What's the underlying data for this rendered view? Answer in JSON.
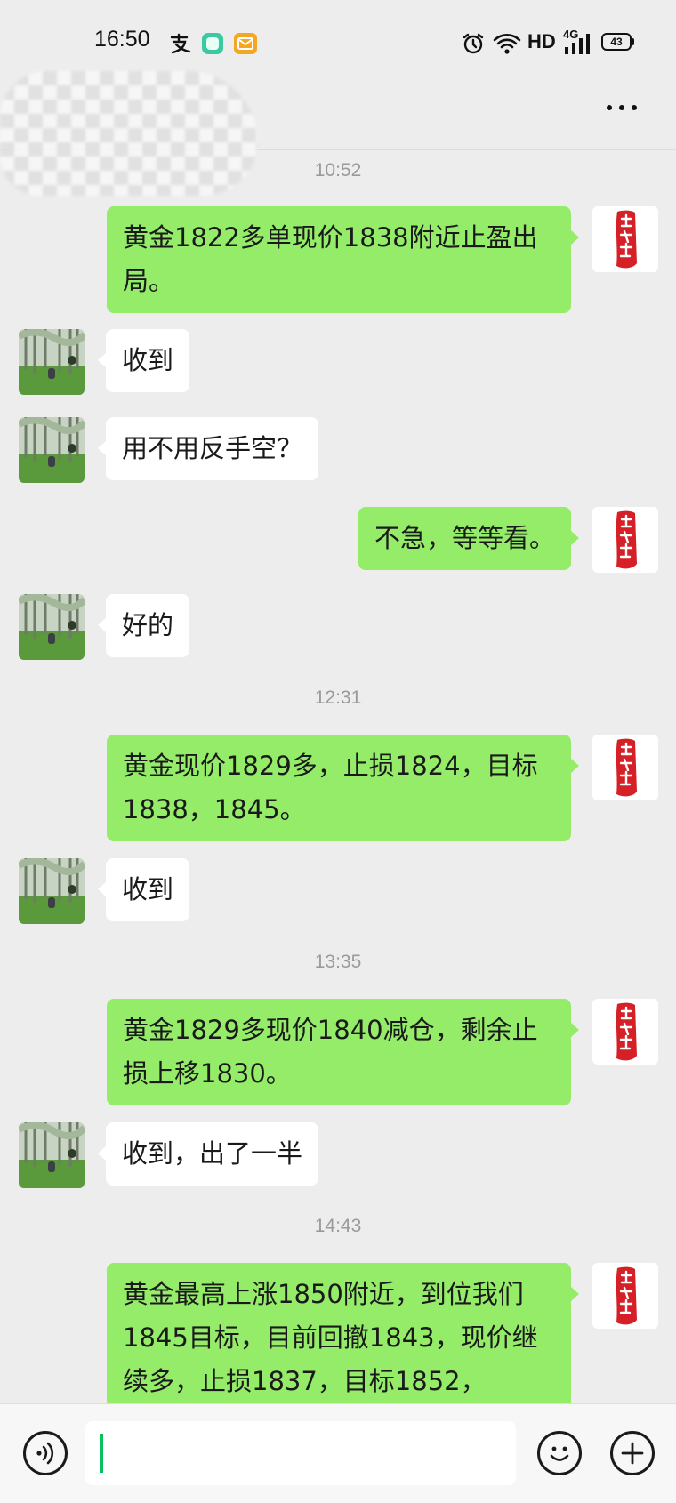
{
  "status_bar": {
    "time": "16:50",
    "network": "HD",
    "signal": "4G",
    "battery": "43",
    "notification_icons": [
      "alipay-icon",
      "green-app-icon",
      "mail-icon"
    ]
  },
  "header": {
    "contact_name": "",
    "more_label": "…"
  },
  "messages": [
    {
      "type": "timestamp",
      "text": "10:52"
    },
    {
      "type": "message",
      "side": "out",
      "text": "黄金1822多单现价1838附近止盈出局。"
    },
    {
      "type": "message",
      "side": "in",
      "text": "收到"
    },
    {
      "type": "message",
      "side": "in",
      "text": "用不用反手空？"
    },
    {
      "type": "message",
      "side": "out",
      "text": "不急，等等看。"
    },
    {
      "type": "message",
      "side": "in",
      "text": "好的"
    },
    {
      "type": "timestamp",
      "text": "12:31"
    },
    {
      "type": "message",
      "side": "out",
      "text": "黄金现价1829多，止损1824，目标1838，1845。"
    },
    {
      "type": "message",
      "side": "in",
      "text": "收到"
    },
    {
      "type": "timestamp",
      "text": "13:35"
    },
    {
      "type": "message",
      "side": "out",
      "text": "黄金1829多现价1840减仓，剩余止损上移1830。"
    },
    {
      "type": "message",
      "side": "in",
      "text": "收到，出了一半"
    },
    {
      "type": "timestamp",
      "text": "14:43"
    },
    {
      "type": "message",
      "side": "out",
      "text": "黄金最高上涨1850附近，到位我们1845目标，目前回撤1843，现价继续多，止损1837，目标1852，"
    }
  ],
  "input": {
    "placeholder": "",
    "value": ""
  },
  "colors": {
    "outgoing_bubble": "#95ec69",
    "incoming_bubble": "#ffffff",
    "background": "#ededed",
    "seal_red": "#d42026"
  }
}
